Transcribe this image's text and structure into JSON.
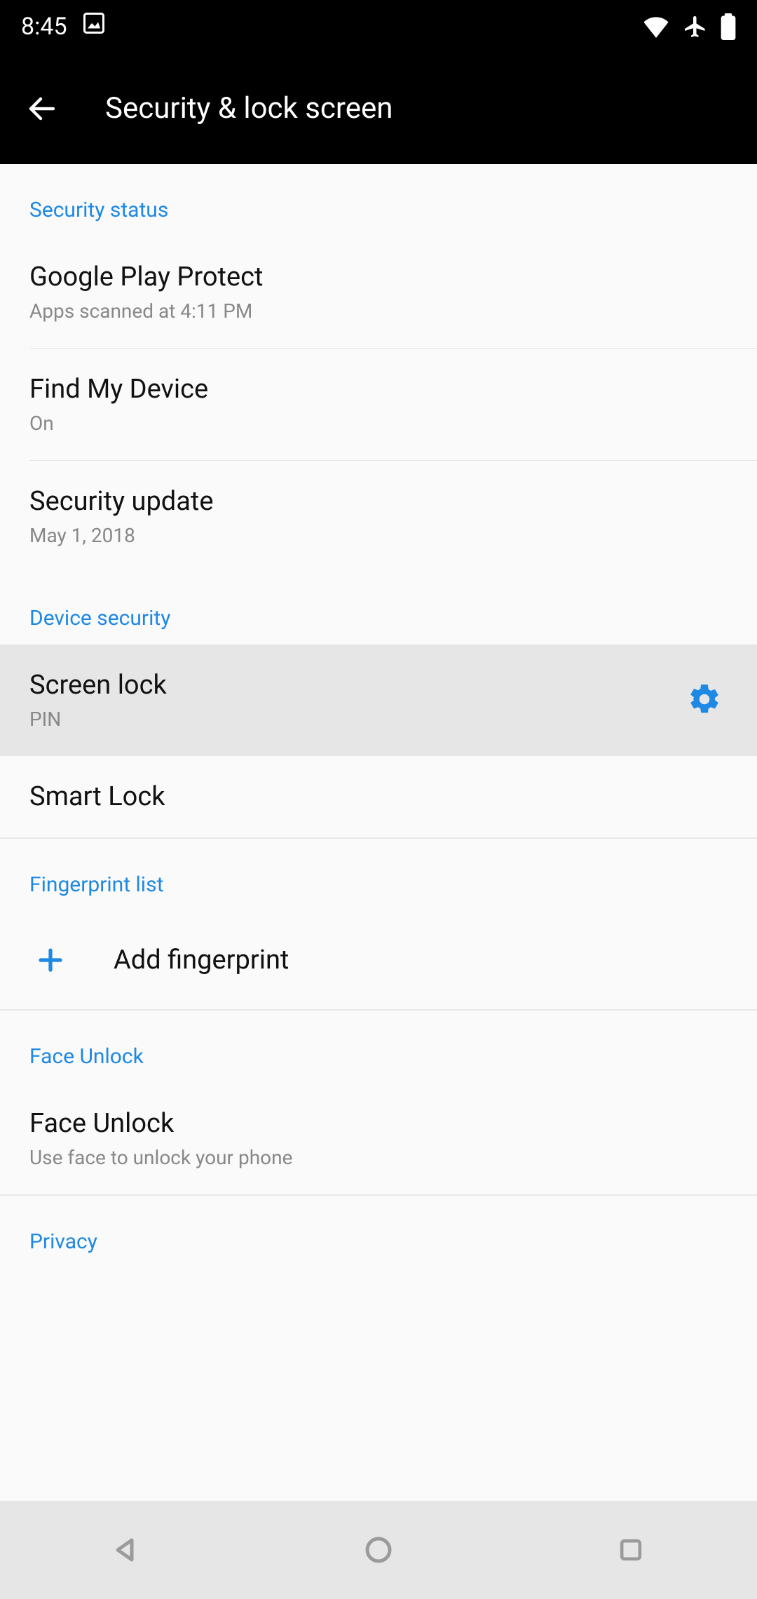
{
  "status": {
    "time": "8:45"
  },
  "header": {
    "title": "Security & lock screen"
  },
  "sections": {
    "security_status": {
      "header": "Security status",
      "play_protect": {
        "title": "Google Play Protect",
        "sub": "Apps scanned at 4:11 PM"
      },
      "find_device": {
        "title": "Find My Device",
        "sub": "On"
      },
      "security_update": {
        "title": "Security update",
        "sub": "May 1, 2018"
      }
    },
    "device_security": {
      "header": "Device security",
      "screen_lock": {
        "title": "Screen lock",
        "sub": "PIN"
      },
      "smart_lock": {
        "title": "Smart Lock"
      }
    },
    "fingerprint": {
      "header": "Fingerprint list",
      "add": {
        "title": "Add fingerprint"
      }
    },
    "face_unlock": {
      "header": "Face Unlock",
      "item": {
        "title": "Face Unlock",
        "sub": "Use face to unlock your phone"
      }
    },
    "privacy": {
      "header": "Privacy"
    }
  },
  "colors": {
    "accent": "#1e88e5"
  }
}
